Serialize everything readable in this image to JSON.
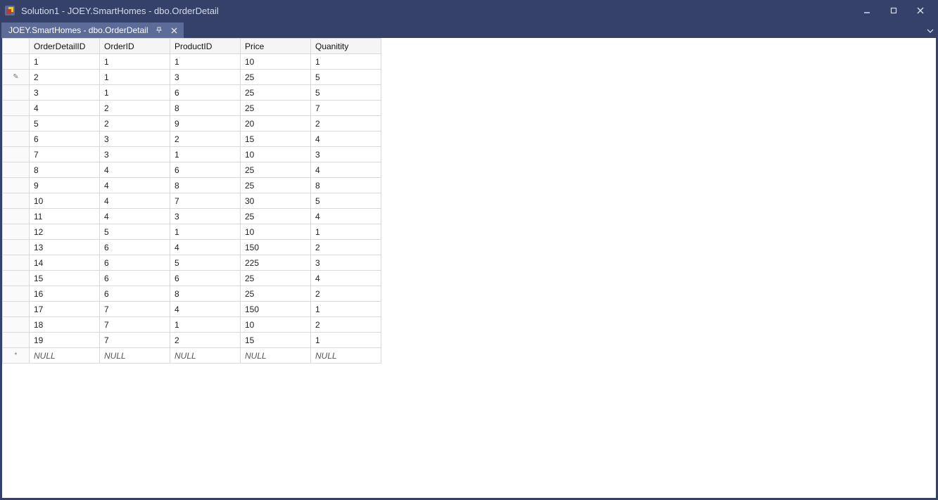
{
  "window": {
    "title": "Solution1 - JOEY.SmartHomes - dbo.OrderDetail"
  },
  "tab": {
    "label": "JOEY.SmartHomes - dbo.OrderDetail"
  },
  "grid": {
    "columns": [
      "OrderDetailID",
      "OrderID",
      "ProductID",
      "Price",
      "Quanitity"
    ],
    "rows": [
      {
        "marker": "",
        "cells": [
          "1",
          "1",
          "1",
          "10",
          "1"
        ]
      },
      {
        "marker": "✎",
        "cells": [
          "2",
          "1",
          "3",
          "25",
          "5"
        ]
      },
      {
        "marker": "",
        "cells": [
          "3",
          "1",
          "6",
          "25",
          "5"
        ]
      },
      {
        "marker": "",
        "cells": [
          "4",
          "2",
          "8",
          "25",
          "7"
        ]
      },
      {
        "marker": "",
        "cells": [
          "5",
          "2",
          "9",
          "20",
          "2"
        ]
      },
      {
        "marker": "",
        "cells": [
          "6",
          "3",
          "2",
          "15",
          "4"
        ]
      },
      {
        "marker": "",
        "cells": [
          "7",
          "3",
          "1",
          "10",
          "3"
        ]
      },
      {
        "marker": "",
        "cells": [
          "8",
          "4",
          "6",
          "25",
          "4"
        ]
      },
      {
        "marker": "",
        "cells": [
          "9",
          "4",
          "8",
          "25",
          "8"
        ]
      },
      {
        "marker": "",
        "cells": [
          "10",
          "4",
          "7",
          "30",
          "5"
        ]
      },
      {
        "marker": "",
        "cells": [
          "11",
          "4",
          "3",
          "25",
          "4"
        ]
      },
      {
        "marker": "",
        "cells": [
          "12",
          "5",
          "1",
          "10",
          "1"
        ]
      },
      {
        "marker": "",
        "cells": [
          "13",
          "6",
          "4",
          "150",
          "2"
        ]
      },
      {
        "marker": "",
        "cells": [
          "14",
          "6",
          "5",
          "225",
          "3"
        ]
      },
      {
        "marker": "",
        "cells": [
          "15",
          "6",
          "6",
          "25",
          "4"
        ]
      },
      {
        "marker": "",
        "cells": [
          "16",
          "6",
          "8",
          "25",
          "2"
        ]
      },
      {
        "marker": "",
        "cells": [
          "17",
          "7",
          "4",
          "150",
          "1"
        ]
      },
      {
        "marker": "",
        "cells": [
          "18",
          "7",
          "1",
          "10",
          "2"
        ]
      },
      {
        "marker": "",
        "cells": [
          "19",
          "7",
          "2",
          "15",
          "1"
        ]
      }
    ],
    "new_row": {
      "marker": "*",
      "null_text": "NULL"
    }
  }
}
